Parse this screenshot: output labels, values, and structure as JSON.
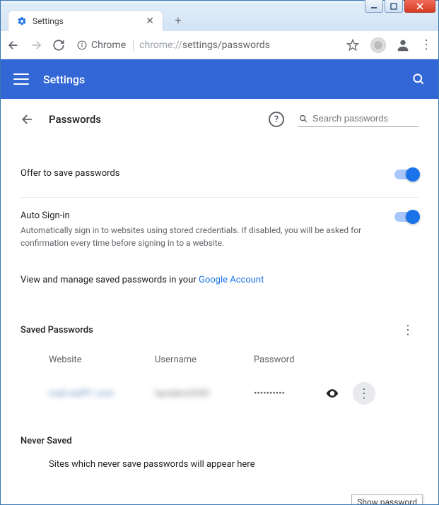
{
  "window": {
    "tab_title": "Settings",
    "omnibox_chip": "Chrome",
    "omnibox_scheme": "chrome://",
    "omnibox_path": "settings/passwords"
  },
  "bluebar": {
    "title": "Settings"
  },
  "page": {
    "title": "Passwords",
    "search_placeholder": "Search passwords",
    "offer_save": "Offer to save passwords",
    "autosign_title": "Auto Sign-in",
    "autosign_desc": "Automatically sign in to websites using stored credentials. If disabled, you will be asked for confirmation every time before signing in to a website.",
    "manage_prefix": "View and manage saved passwords in your ",
    "manage_link": "Google Account",
    "saved_heading": "Saved Passwords",
    "col_website": "Website",
    "col_username": "Username",
    "col_password": "Password",
    "row_website": "mail.redff1.com",
    "row_username": "hpriders2550",
    "row_password_mask": "••••••••••",
    "tooltip": "Show password",
    "never_heading": "Never Saved",
    "never_text": "Sites which never save passwords will appear here"
  }
}
